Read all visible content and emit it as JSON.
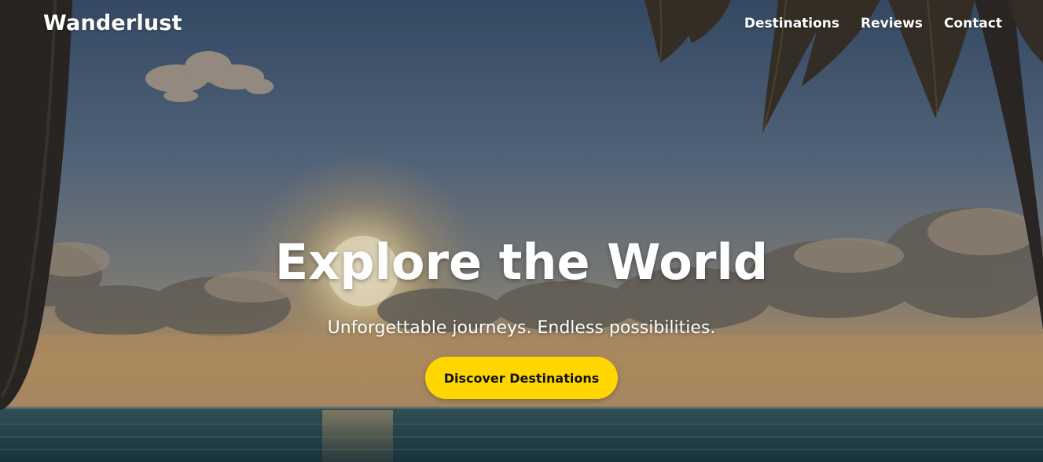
{
  "brand": {
    "name": "Wanderlust"
  },
  "nav": {
    "items": [
      {
        "label": "Destinations"
      },
      {
        "label": "Reviews"
      },
      {
        "label": "Contact"
      }
    ]
  },
  "hero": {
    "title": "Explore the World",
    "subtitle": "Unforgettable journeys. Endless possibilities.",
    "cta_label": "Discover Destinations",
    "background": "tropical-beach-sunset-with-palm-trees"
  },
  "colors": {
    "accent": "#ffd600",
    "text": "#ffffff",
    "sky_top": "#3f5673",
    "sky_mid": "#6f8296",
    "horizon_glow": "#c9a46f",
    "sea": "#24464f"
  }
}
